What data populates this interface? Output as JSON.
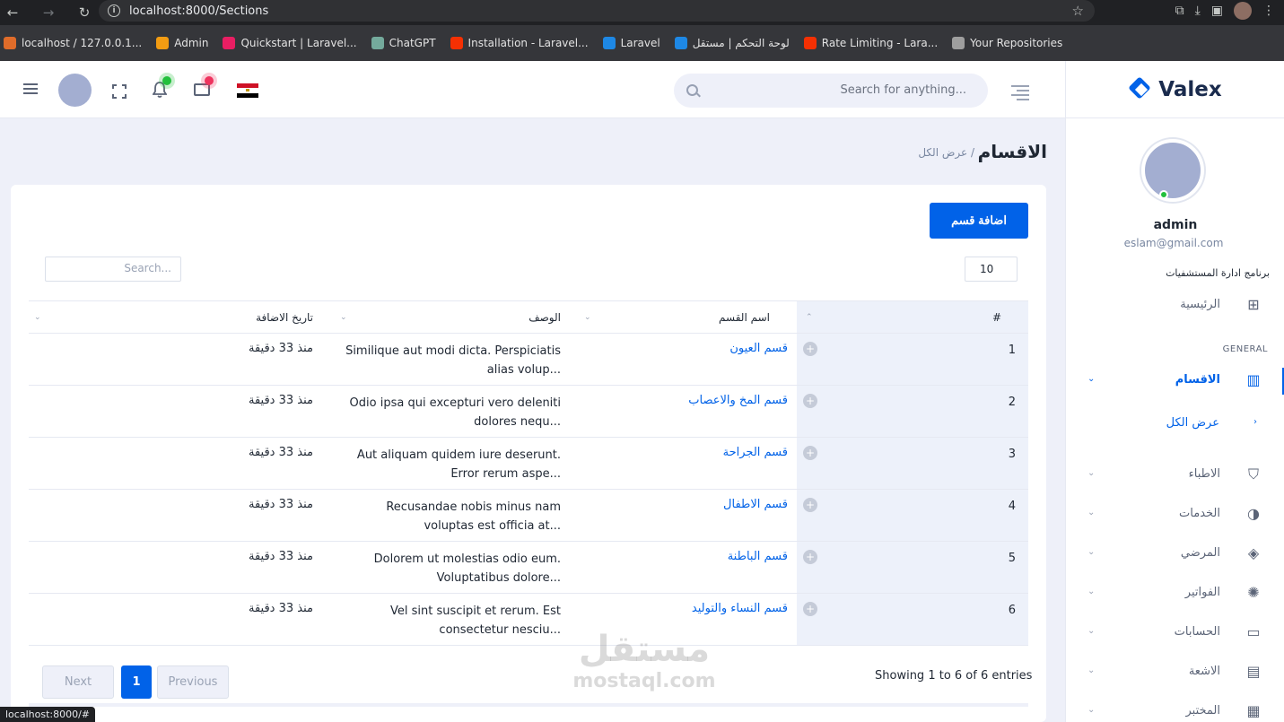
{
  "browser": {
    "url": "localhost:8000/Sections",
    "bookmarks": [
      {
        "label": "localhost / 127.0.0.1...",
        "color": "#e06c2a"
      },
      {
        "label": "Admin",
        "color": "#f39c12"
      },
      {
        "label": "Quickstart | Laravel...",
        "color": "#e91e63"
      },
      {
        "label": "ChatGPT",
        "color": "#74aa9c"
      },
      {
        "label": "Installation - Laravel...",
        "color": "#f53003"
      },
      {
        "label": "Laravel",
        "color": "#1e88e5"
      },
      {
        "label": "لوحة التحكم | مستقل",
        "color": "#1e88e5"
      },
      {
        "label": "Rate Limiting - Lara...",
        "color": "#f53003"
      },
      {
        "label": "Your Repositories",
        "color": "#9e9e9e"
      }
    ],
    "status_url": "localhost:8000/#"
  },
  "header": {
    "search_placeholder": "Search for anything..."
  },
  "sidebar": {
    "logo": "Valex",
    "user_name": "admin",
    "user_email": "eslam@gmail.com",
    "app_label": "برنامج ادارة المستشفيات",
    "home": "الرئيسية",
    "general": "GENERAL",
    "sections": "الاقسام",
    "view_all": "عرض الكل",
    "doctors": "الاطباء",
    "services": "الخدمات",
    "patients": "المرضي",
    "invoices": "الفواتير",
    "accounts": "الحسابات",
    "radiology": "الاشعة",
    "lab": "المختبر"
  },
  "page": {
    "title": "الاقسام",
    "breadcrumb": "/ عرض الكل",
    "add_button": "اضافة قسم",
    "page_length": "10",
    "search_placeholder": "Search...",
    "columns": {
      "num": "#",
      "name": "اسم القسم",
      "desc": "الوصف",
      "date": "تاريخ الاضافة"
    },
    "rows": [
      {
        "num": "1",
        "name": "قسم العيون",
        "desc": "Similique aut modi dicta. Perspiciatis alias volup...",
        "date": "منذ 33 دقيقة"
      },
      {
        "num": "2",
        "name": "قسم المخ والاعصاب",
        "desc": "Odio ipsa qui excepturi vero deleniti dolores nequ...",
        "date": "منذ 33 دقيقة"
      },
      {
        "num": "3",
        "name": "قسم الجراحة",
        "desc": "Aut aliquam quidem iure deserunt. Error rerum aspe...",
        "date": "منذ 33 دقيقة"
      },
      {
        "num": "4",
        "name": "قسم الاطفال",
        "desc": "Recusandae nobis minus nam voluptas est officia at...",
        "date": "منذ 33 دقيقة"
      },
      {
        "num": "5",
        "name": "قسم الباطنة",
        "desc": "Dolorem ut molestias odio eum. Voluptatibus dolore...",
        "date": "منذ 33 دقيقة"
      },
      {
        "num": "6",
        "name": "قسم النساء والتوليد",
        "desc": "Vel sint suscipit et rerum. Est consectetur nesciu...",
        "date": "منذ 33 دقيقة"
      }
    ],
    "showing": "Showing 1 to 6 of 6 entries",
    "next": "Next",
    "current_page": "1",
    "previous": "Previous"
  },
  "watermark": {
    "ar": "مستقل",
    "en": "mostaql.com"
  }
}
